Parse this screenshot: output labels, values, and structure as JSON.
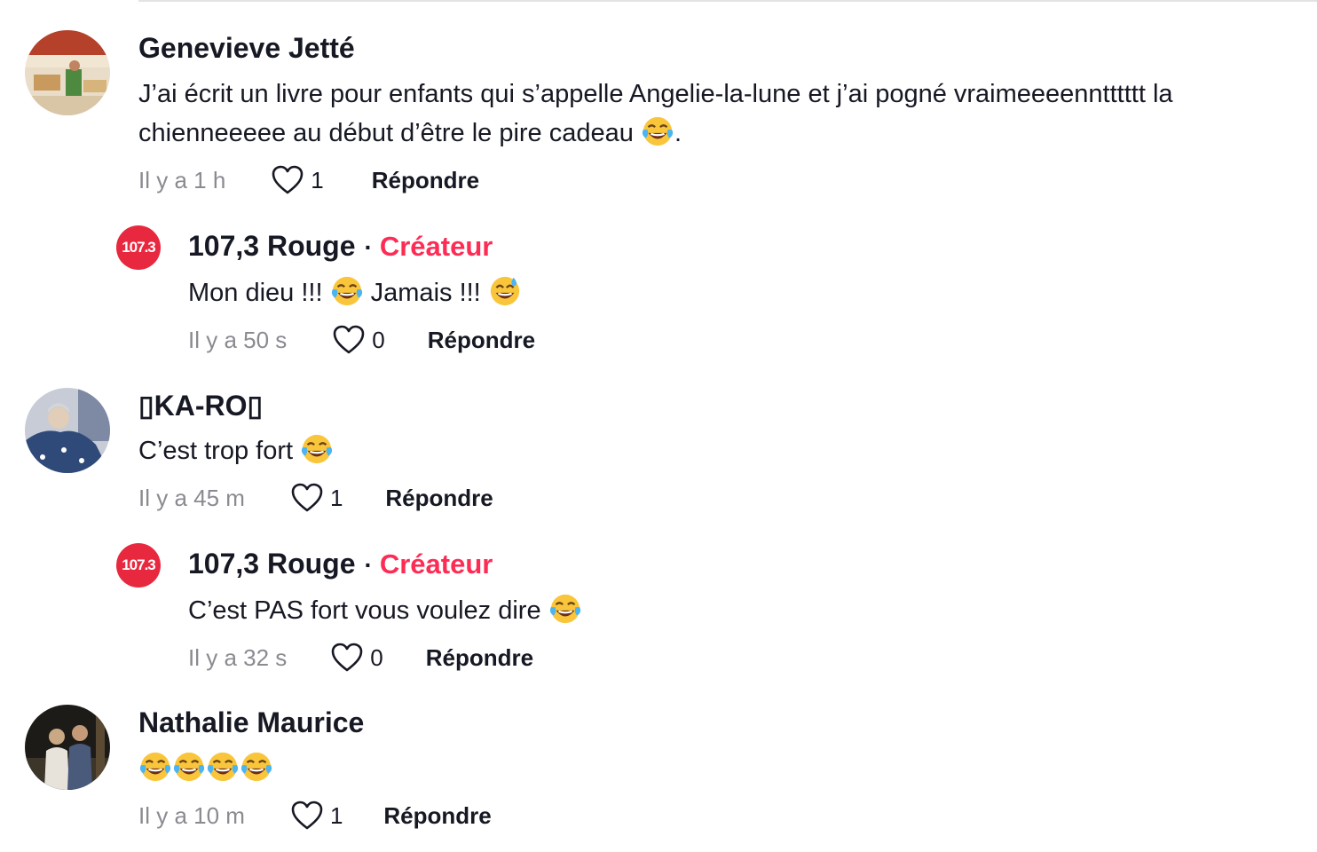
{
  "comments": [
    {
      "username": "Genevieve Jetté",
      "text_lines": [
        "J’ai écrit un livre pour enfants qui s’appelle Angelie-la-lune et j’ai pogné vraimeeeenntttttt la",
        "chienneeeee au début d’être le pire cadeau "
      ],
      "text_suffix": ".",
      "emoji": "face-with-tears-of-joy",
      "timestamp": "Il y a 1 h",
      "likes": "1",
      "reply_label": "Répondre"
    },
    {
      "username": "107,3 Rouge",
      "badge": "Créateur",
      "avatar_text": "107.3",
      "text_parts": [
        "Mon dieu !!! ",
        " Jamais !!! "
      ],
      "emoji": [
        "face-with-tears-of-joy",
        "grinning-face-with-sweat"
      ],
      "timestamp": "Il y a 50 s",
      "likes": "0",
      "reply_label": "Répondre"
    },
    {
      "username": "▯KA-RO▯",
      "text": "C’est trop fort ",
      "emoji": "face-with-tears-of-joy",
      "timestamp": "Il y a 45 m",
      "likes": "1",
      "reply_label": "Répondre"
    },
    {
      "username": "107,3 Rouge",
      "badge": "Créateur",
      "avatar_text": "107.3",
      "text": "C’est PAS fort vous voulez dire ",
      "emoji": "face-with-tears-of-joy",
      "timestamp": "Il y a 32 s",
      "likes": "0",
      "reply_label": "Répondre"
    },
    {
      "username": "Nathalie Maurice",
      "emoji": [
        "face-with-tears-of-joy",
        "face-with-tears-of-joy",
        "face-with-tears-of-joy",
        "face-with-tears-of-joy"
      ],
      "timestamp": "Il y a 10 m",
      "likes": "1",
      "reply_label": "Répondre"
    }
  ],
  "colors": {
    "text": "#161823",
    "muted": "#8a8b91",
    "creator": "#fe2c55",
    "brand_red": "#e8283f",
    "emoji_yellow": "#f9c63b"
  }
}
